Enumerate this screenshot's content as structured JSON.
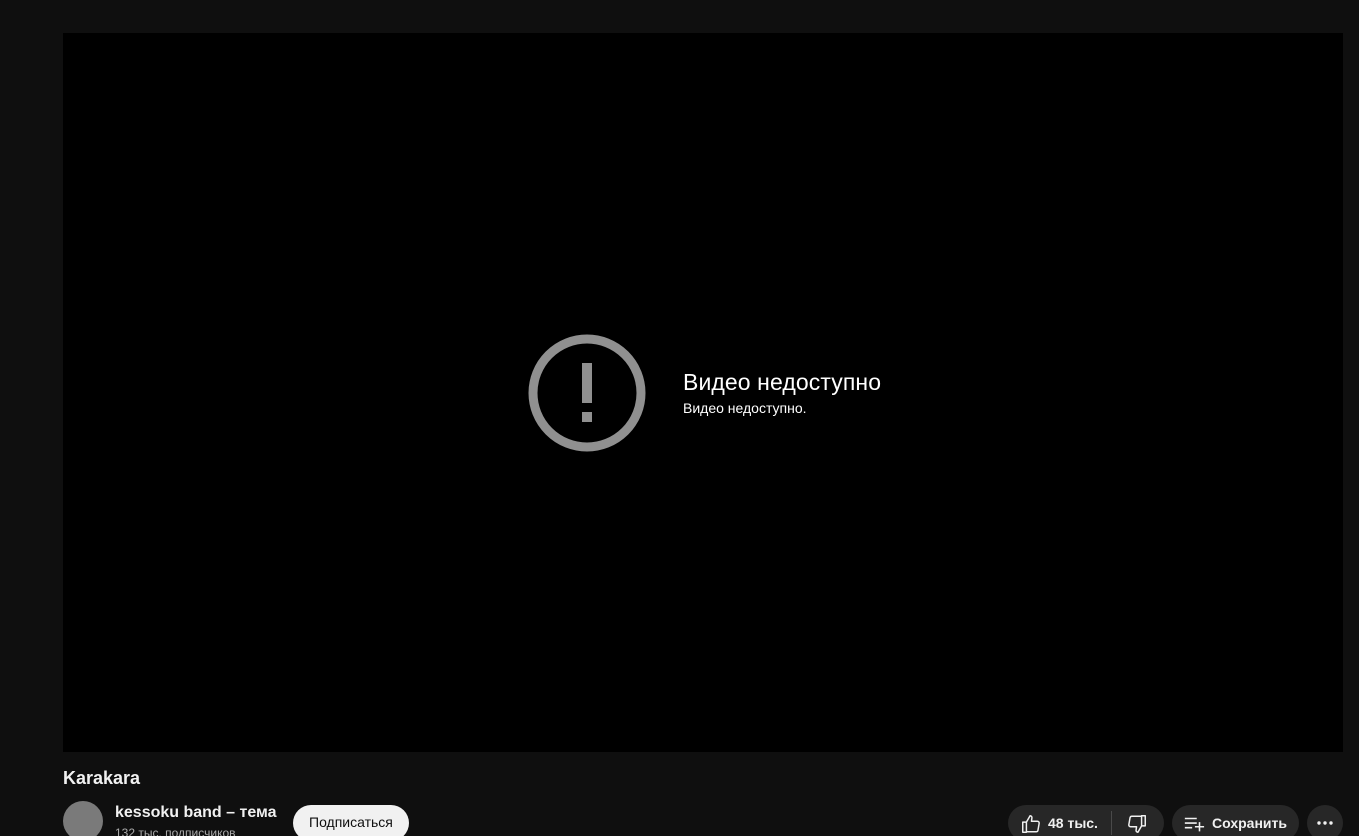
{
  "player": {
    "error_title": "Видео недоступно",
    "error_subtitle": "Видео недоступно.",
    "error_icon": "alert-circle-icon"
  },
  "video": {
    "title": "Karakara"
  },
  "channel": {
    "name": "kessoku band – тема",
    "subscribers": "132 тыс. подписчиков",
    "subscribe_label": "Подписаться"
  },
  "actions": {
    "like_count": "48 тыс.",
    "save_label": "Сохранить",
    "like_icon": "thumbs-up-icon",
    "dislike_icon": "thumbs-down-icon",
    "save_icon": "playlist-add-icon",
    "more_icon": "more-horizontal-icon"
  },
  "colors": {
    "background": "#0f0f0f",
    "player_bg": "#000000",
    "button_bg": "#272727",
    "subscribe_bg": "#f1f1f1",
    "error_icon": "#909090"
  }
}
